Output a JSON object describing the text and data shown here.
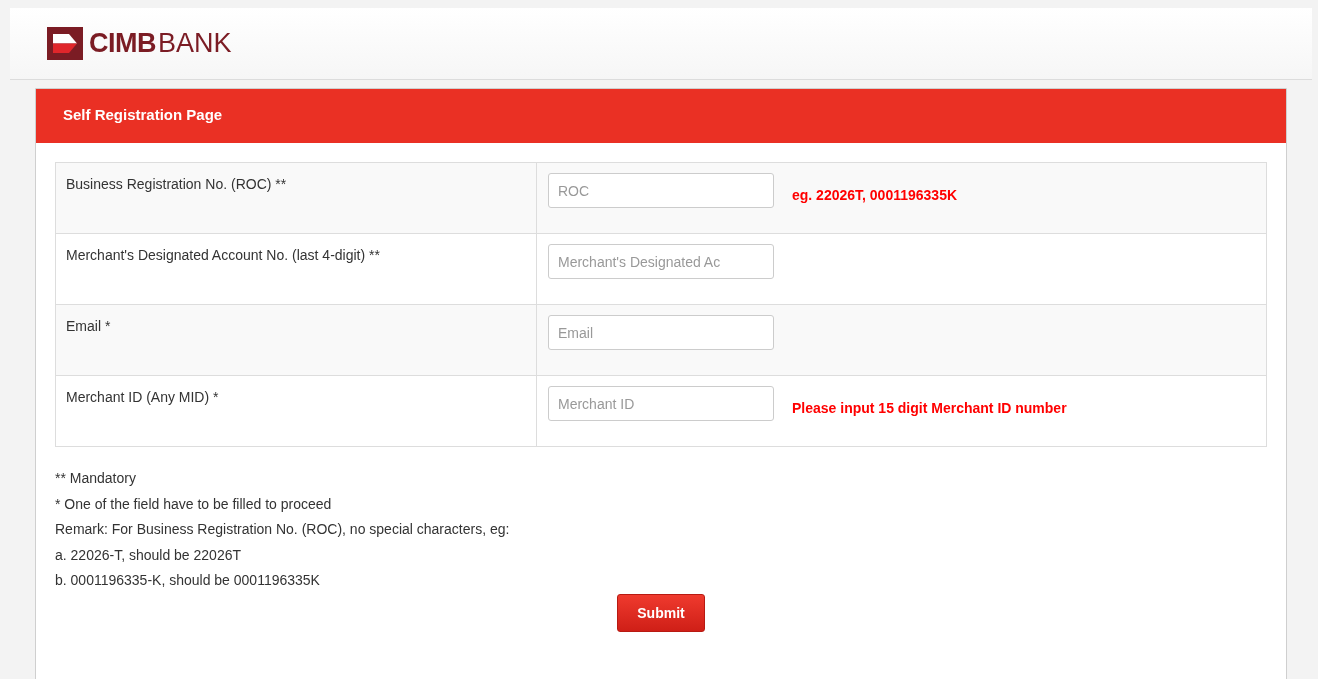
{
  "header": {
    "logo": {
      "brand": "CIMB",
      "suffix": "BANK"
    }
  },
  "panel": {
    "title": "Self Registration Page",
    "rows": [
      {
        "label": "Business Registration No. (ROC) **",
        "placeholder": "ROC",
        "hint": "eg. 22026T, 0001196335K"
      },
      {
        "label": "Merchant's Designated Account No. (last 4-digit) **",
        "placeholder": "Merchant's Designated Ac"
      },
      {
        "label": "Email *",
        "placeholder": "Email"
      },
      {
        "label": "Merchant ID (Any MID) *",
        "placeholder": "Merchant ID",
        "hint": "Please input 15 digit Merchant ID number"
      }
    ],
    "notes": [
      "** Mandatory",
      "* One of the field have to be filled to proceed",
      "Remark: For Business Registration No. (ROC), no special characters, eg:",
      "a. 22026-T, should be 22026T",
      "b. 0001196335-K, should be 0001196335K"
    ],
    "submit": "Submit"
  }
}
